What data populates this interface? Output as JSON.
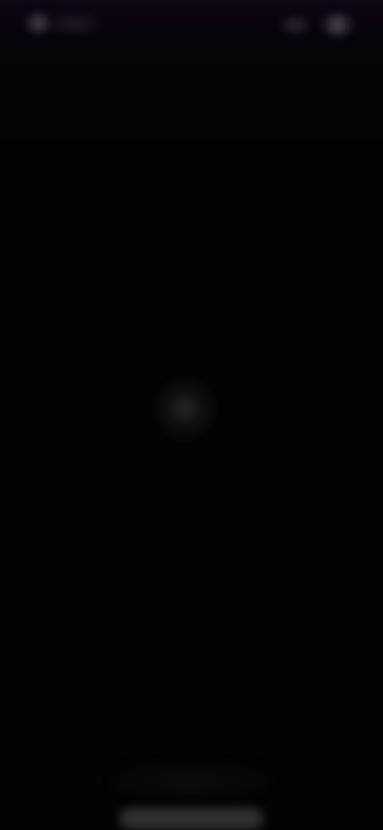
{
  "screen": {
    "background_color": "#050207",
    "state": "loading"
  },
  "status_bar": {
    "time": "",
    "signal_icon": "signal-icon",
    "battery_icon": "battery-icon"
  },
  "main": {
    "spinner_icon": "loading-spinner-icon"
  },
  "bottom": {
    "home_indicator": "home-indicator"
  }
}
